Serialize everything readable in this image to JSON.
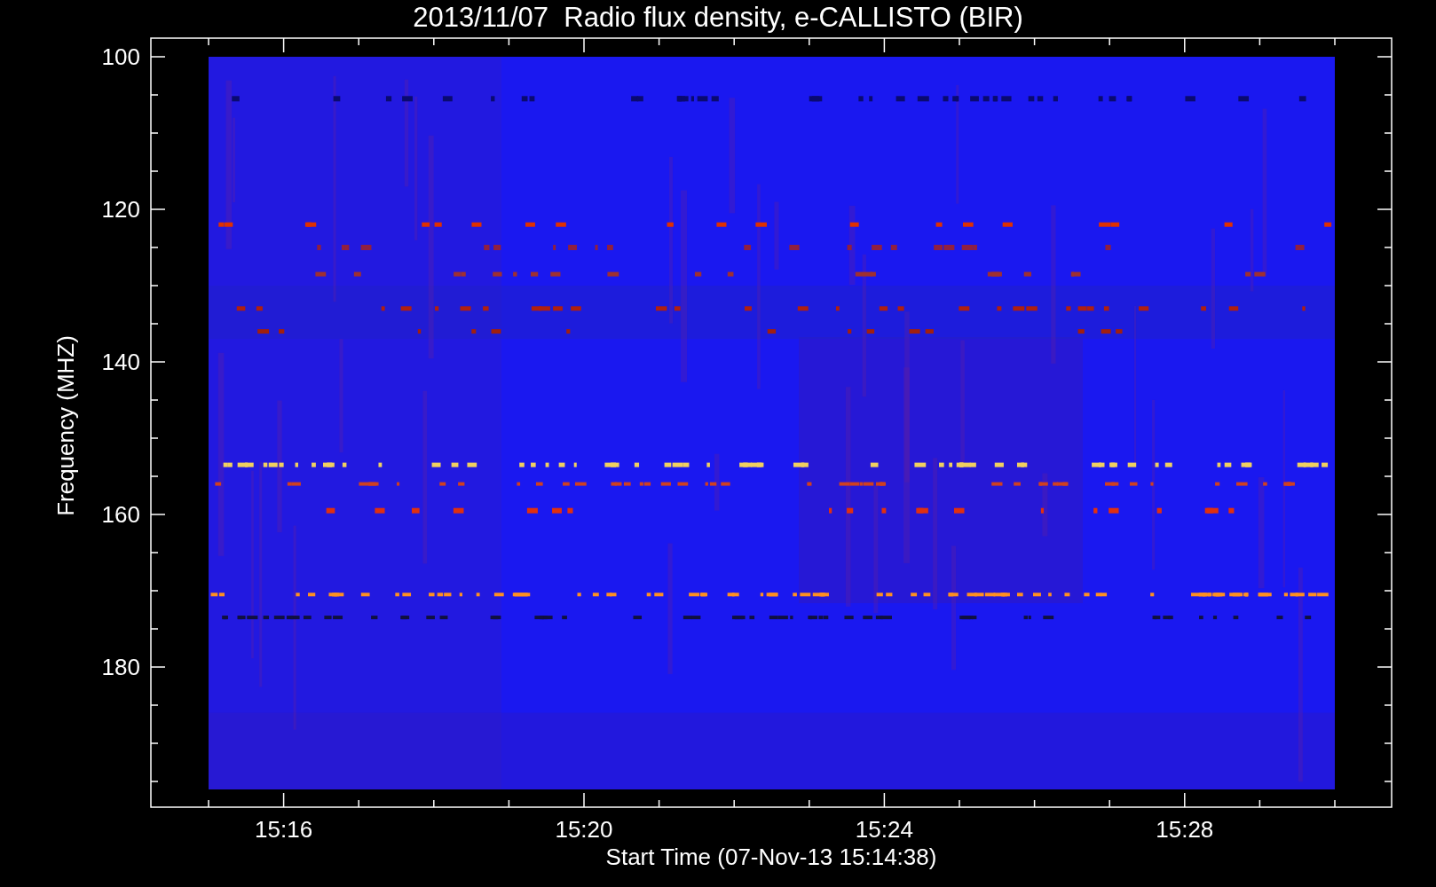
{
  "title": "2013/11/07  Radio flux density, e-CALLISTO (BIR)",
  "y_axis": {
    "label": "Frequency (MHZ)",
    "ticks": [
      "100",
      "120",
      "140",
      "160",
      "180"
    ]
  },
  "x_axis": {
    "label": "Start Time (07-Nov-13 15:14:38)",
    "ticks": [
      "15:16",
      "15:20",
      "15:24",
      "15:28"
    ]
  }
}
